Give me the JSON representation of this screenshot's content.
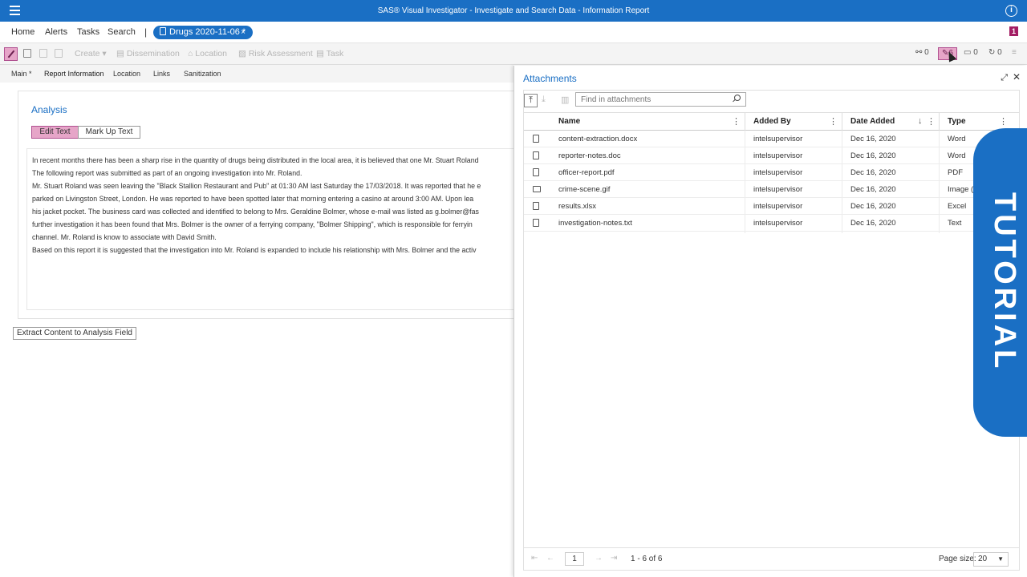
{
  "titlebar": {
    "title": "SAS® Visual Investigator - Investigate and Search Data - Information Report",
    "info_icon": "i"
  },
  "nav": {
    "items": [
      "Home",
      "Alerts",
      "Tasks",
      "Search"
    ],
    "separator": "|",
    "doc_tab": "Drugs 2020-11-06 *",
    "doc_tab_close": "×",
    "badge": "1"
  },
  "toolbar": {
    "create": "Create ▾",
    "dissemination": "Dissemination",
    "location": "Location",
    "risk": "Risk Assessment",
    "task": "Task",
    "links_count": "0",
    "attach_count": "6",
    "comments_count": "0",
    "other_count": "0"
  },
  "tabs": [
    "Main *",
    "Report Information",
    "Location",
    "Links",
    "Sanitization"
  ],
  "analysis": {
    "title": "Analysis",
    "edit_text": "Edit Text",
    "markup_text": "Mark Up Text",
    "lines": [
      "In recent months there has been a sharp rise in the quantity of drugs being distributed in the local area, it is believed that one Mr. Stuart Roland",
      "The following report was submitted as part of an ongoing investigation into Mr. Roland.",
      "Mr. Stuart Roland was seen leaving the \"Black Stallion Restaurant and Pub\" at 01:30 AM last Saturday the 17/03/2018. It was reported that he e",
      "parked on Livingston Street, London. He was reported to have been spotted later that morning entering a casino at around 3:00 AM. Upon lea",
      "his jacket pocket. The business card was collected and identified to belong to Mrs. Geraldine Bolmer, whose e-mail was listed as g.bolmer@fas",
      "further investigation it has been found that Mrs. Bolmer is the owner of a ferrying company, \"Bolmer Shipping\", which is responsible for ferryin",
      "channel. Mr. Roland is know to associate with David Smith.",
      "Based on this report it is suggested that the investigation into Mr. Roland is expanded to include his relationship with Mrs. Bolmer and the activ"
    ],
    "extract_button": "Extract Content to Analysis Field"
  },
  "attachments": {
    "title": "Attachments",
    "search_placeholder": "Find in attachments",
    "columns": [
      "Name",
      "Added By",
      "Date Added",
      "Type"
    ],
    "sort_indicator": "↓",
    "rows": [
      {
        "name": "content-extraction.docx",
        "added_by": "intelsupervisor",
        "date": "Dec 16, 2020",
        "type": "Word"
      },
      {
        "name": "reporter-notes.doc",
        "added_by": "intelsupervisor",
        "date": "Dec 16, 2020",
        "type": "Word"
      },
      {
        "name": "officer-report.pdf",
        "added_by": "intelsupervisor",
        "date": "Dec 16, 2020",
        "type": "PDF"
      },
      {
        "name": "crime-scene.gif",
        "added_by": "intelsupervisor",
        "date": "Dec 16, 2020",
        "type": "Image ("
      },
      {
        "name": "results.xlsx",
        "added_by": "intelsupervisor",
        "date": "Dec 16, 2020",
        "type": "Excel"
      },
      {
        "name": "investigation-notes.txt",
        "added_by": "intelsupervisor",
        "date": "Dec 16, 2020",
        "type": "Text"
      }
    ],
    "pager": {
      "page": "1",
      "range": "1 - 6 of 6",
      "page_size_label": "Page size:",
      "page_size": "20"
    }
  },
  "tutorial": "TUTORIAL",
  "colors": {
    "brand": "#1a6fc4",
    "active_pink": "#e6a5c8",
    "badge": "#a31e64"
  }
}
